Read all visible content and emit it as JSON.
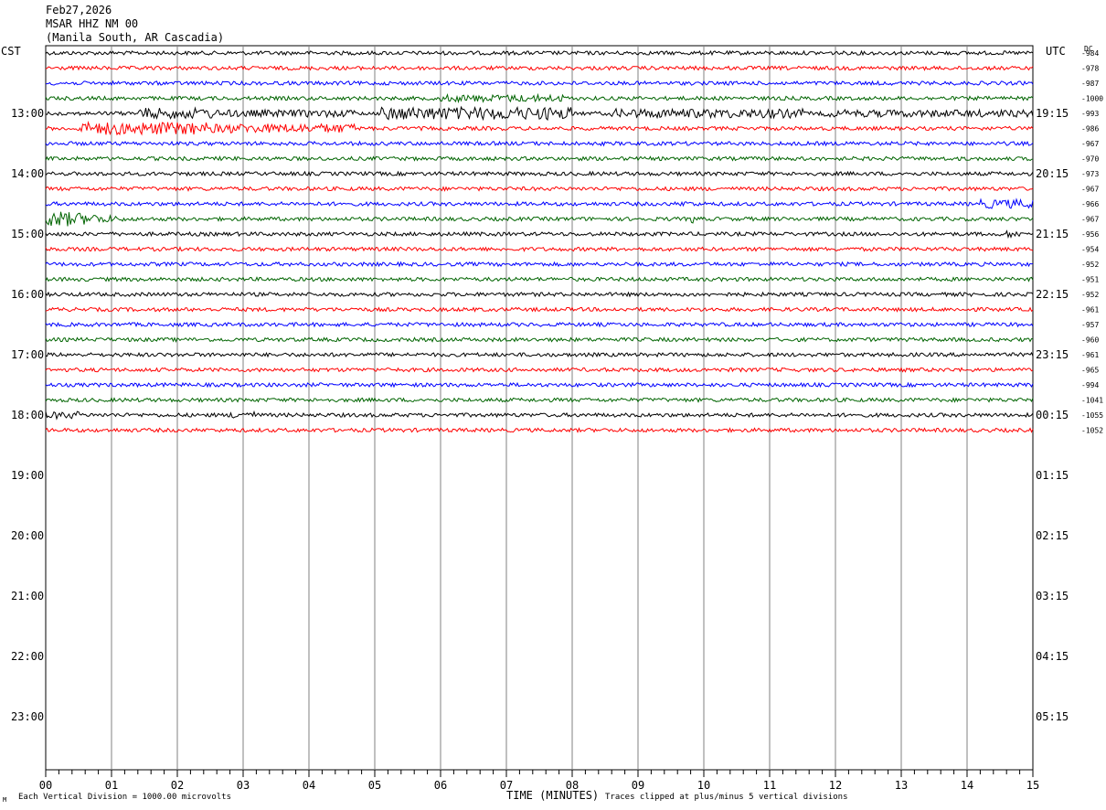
{
  "header": {
    "date": "Feb27,2026",
    "station": "MSAR HHZ NM 00",
    "location": "(Manila South, AR Cascadia)"
  },
  "left_timezone": "CST",
  "right_timezone": "UTC",
  "dc_label": "DC",
  "corner_mark": "M",
  "footer": {
    "scale_note": "Each Vertical Division = 1000.00 microvolts",
    "clip_note": "Traces clipped at plus/minus 5 vertical divisions"
  },
  "colors": {
    "trace_cycle": [
      "#000000",
      "#ff0000",
      "#0000ff",
      "#006400"
    ],
    "grid": "#808080",
    "frame": "#000000"
  },
  "chart_data": {
    "type": "line",
    "xlabel": "TIME (MINUTES)",
    "xlim": [
      0,
      15
    ],
    "x_ticks": [
      "00",
      "01",
      "02",
      "03",
      "04",
      "05",
      "06",
      "07",
      "08",
      "09",
      "10",
      "11",
      "12",
      "13",
      "14",
      "15"
    ],
    "left_hour_labels": [
      "13:00",
      "14:00",
      "15:00",
      "16:00",
      "17:00",
      "18:00",
      "19:00",
      "20:00",
      "21:00",
      "22:00",
      "23:00"
    ],
    "right_hour_labels": [
      "19:15",
      "20:15",
      "21:15",
      "22:15",
      "23:15",
      "00:15",
      "01:15",
      "02:15",
      "03:15",
      "04:15",
      "05:15"
    ],
    "dc_offsets": [
      -984,
      -978,
      -987,
      -1000,
      -993,
      -986,
      -967,
      -970,
      -973,
      -967,
      -966,
      -967,
      -956,
      -954,
      -952,
      -951,
      -952,
      -961,
      -957,
      -960,
      -961,
      -965,
      -994,
      -1041,
      -1055,
      -1052
    ],
    "trace_minutes_per_row": 15,
    "rows_recorded": 26,
    "rows_total": 48
  }
}
